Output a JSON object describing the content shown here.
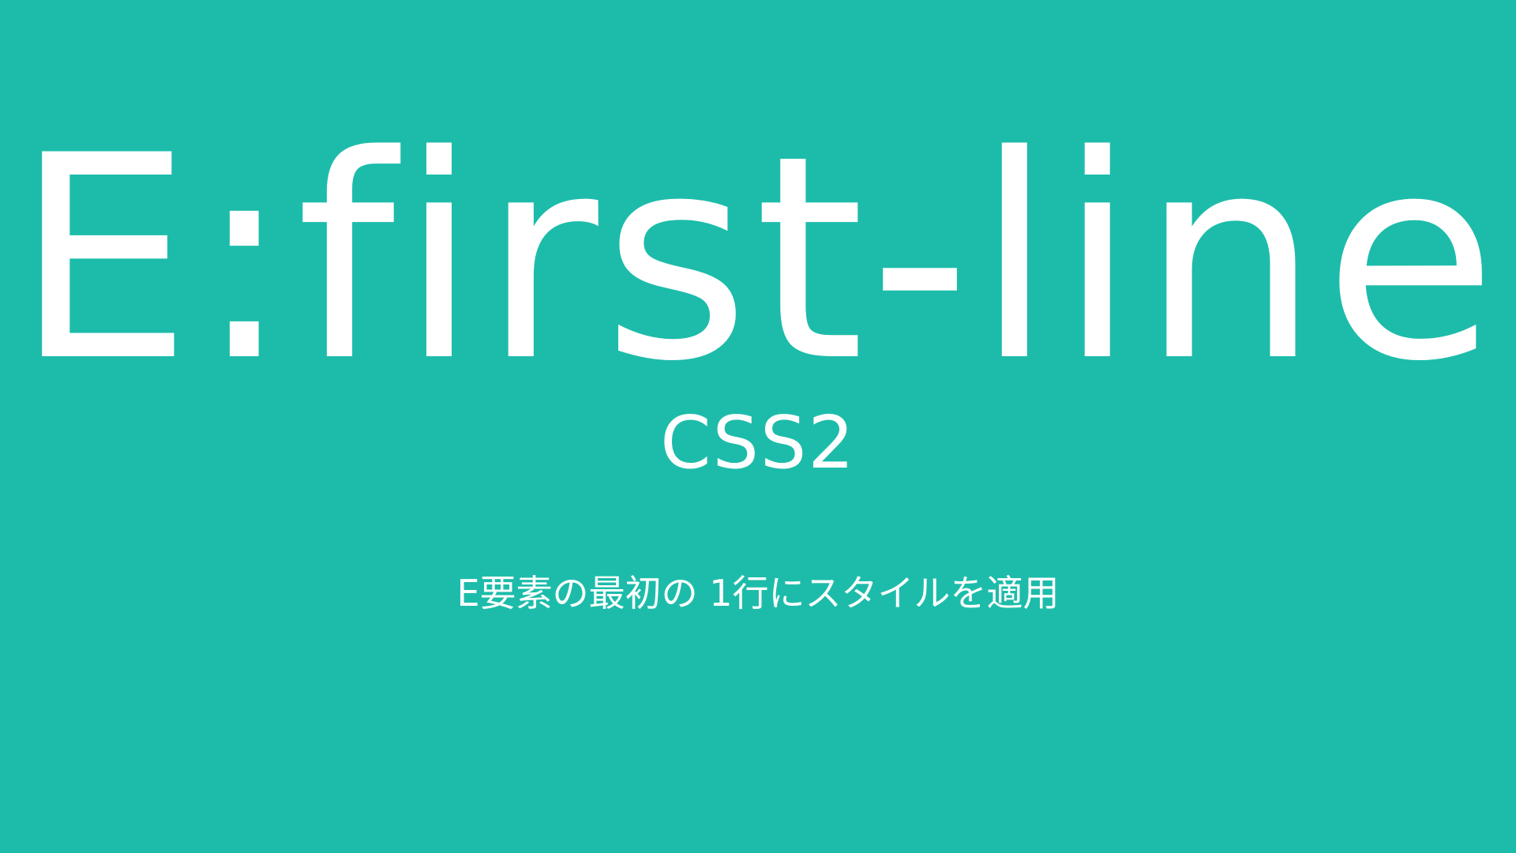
{
  "slide": {
    "title": "E:first-line",
    "version": "CSS2",
    "description": "E要素の最初の 1行にスタイルを適用"
  },
  "colors": {
    "background": "#1DBCAA",
    "text": "#FFFFFF"
  }
}
